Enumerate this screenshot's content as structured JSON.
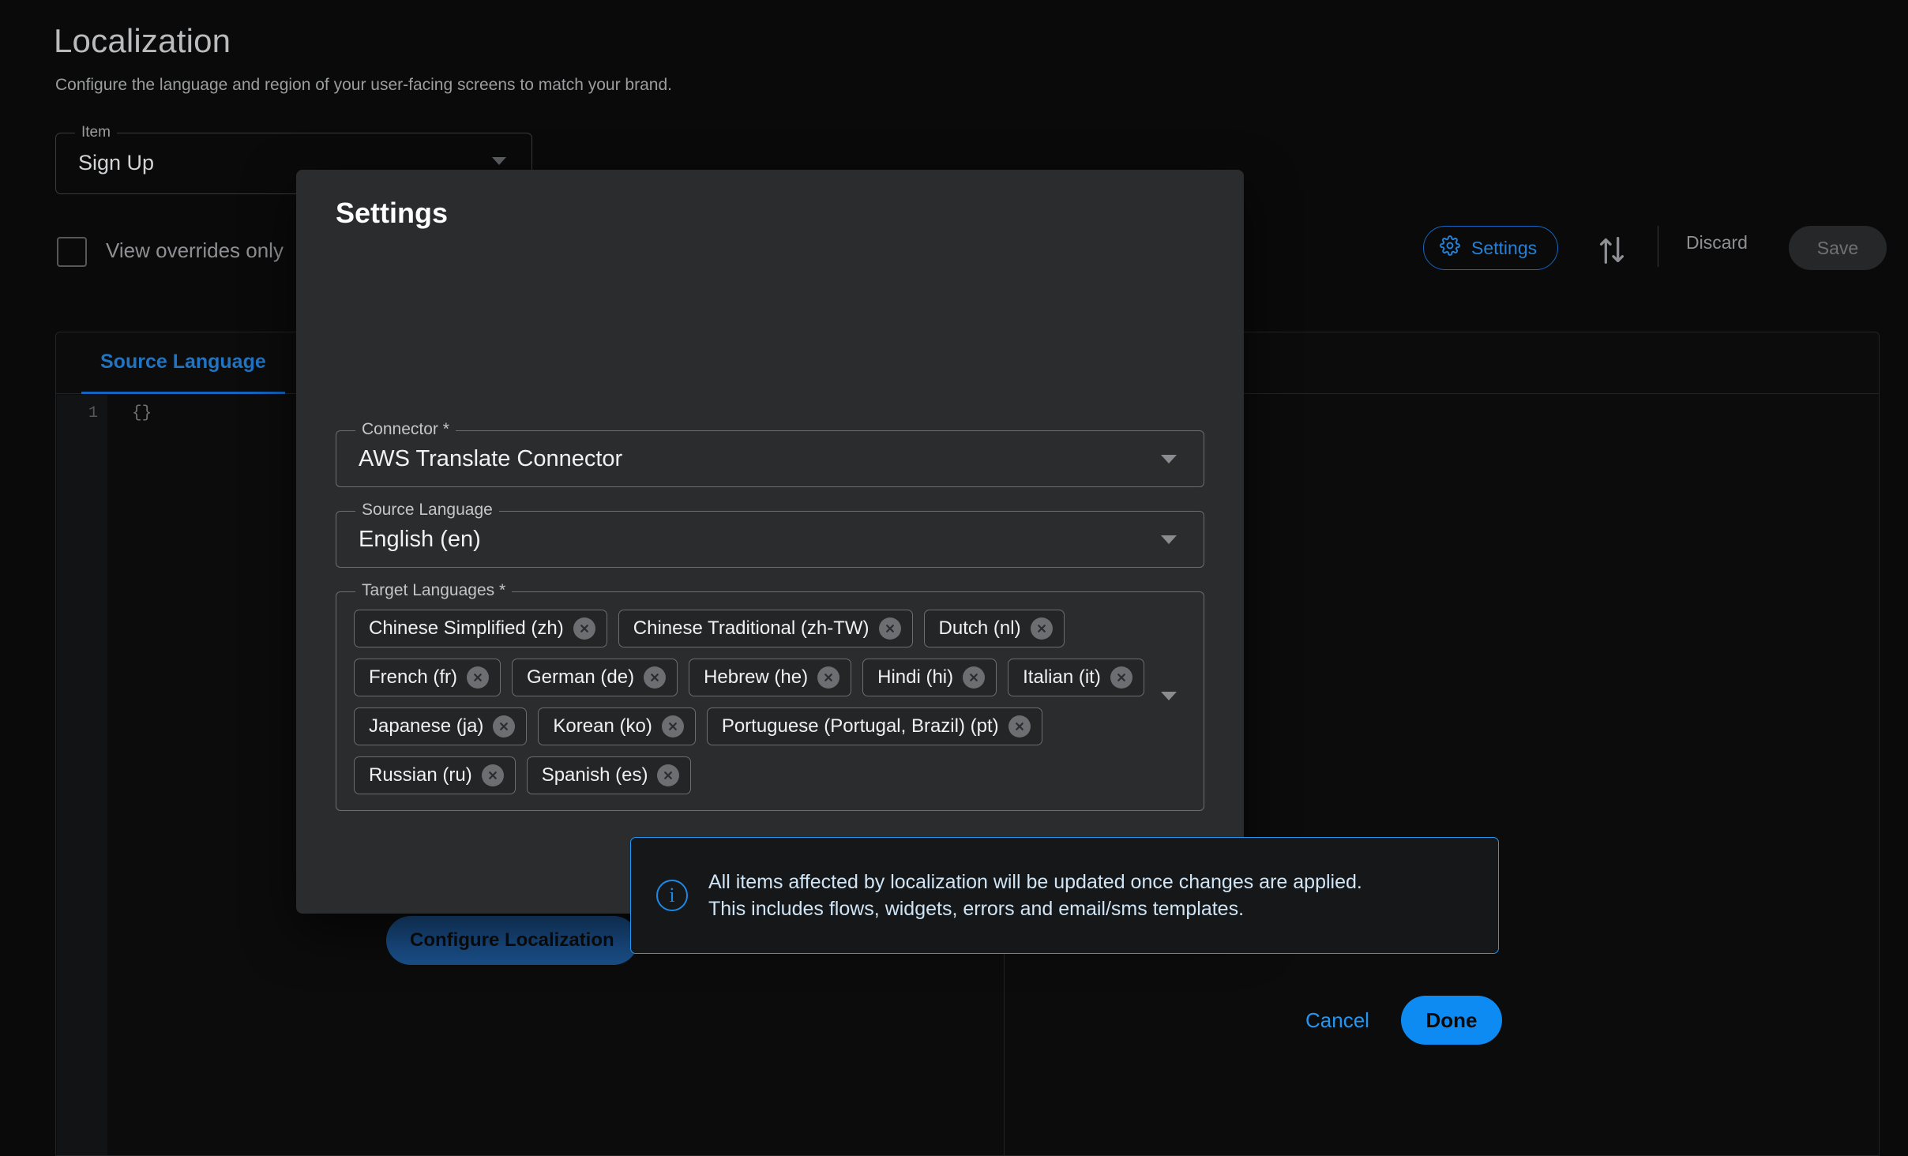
{
  "background": {
    "page_title": "Localization",
    "page_subtitle": "Configure the language and region of your user-facing screens to match your brand.",
    "item_field": {
      "legend": "Item",
      "value": "Sign Up"
    },
    "overrides_checkbox_label": "View overrides only",
    "toolbar": {
      "settings_label": "Settings",
      "discard_label": "Discard",
      "save_label": "Save"
    },
    "editor": {
      "tab_label": "Source Language",
      "line_number": "1",
      "code": "{}"
    },
    "configure_button_label": "Configure Localization",
    "colors": {
      "accent": "#2196f3",
      "settings_outline": "#1565c0"
    }
  },
  "modal": {
    "title": "Settings",
    "connector": {
      "legend": "Connector *",
      "value": "AWS Translate Connector"
    },
    "source_language": {
      "legend": "Source Language",
      "value": "English (en)"
    },
    "target_languages": {
      "legend": "Target Languages *",
      "chips": [
        "Chinese Simplified (zh)",
        "Chinese Traditional (zh-TW)",
        "Dutch (nl)",
        "French (fr)",
        "German (de)",
        "Hebrew (he)",
        "Hindi (hi)",
        "Italian (it)",
        "Japanese (ja)",
        "Korean (ko)",
        "Portuguese (Portugal, Brazil) (pt)",
        "Russian (ru)",
        "Spanish (es)"
      ]
    },
    "info": {
      "line1": "All items affected by localization will be updated once changes are applied.",
      "line2": "This includes flows, widgets, errors and email/sms templates.",
      "icon_glyph": "i"
    },
    "cancel_label": "Cancel",
    "done_label": "Done"
  }
}
